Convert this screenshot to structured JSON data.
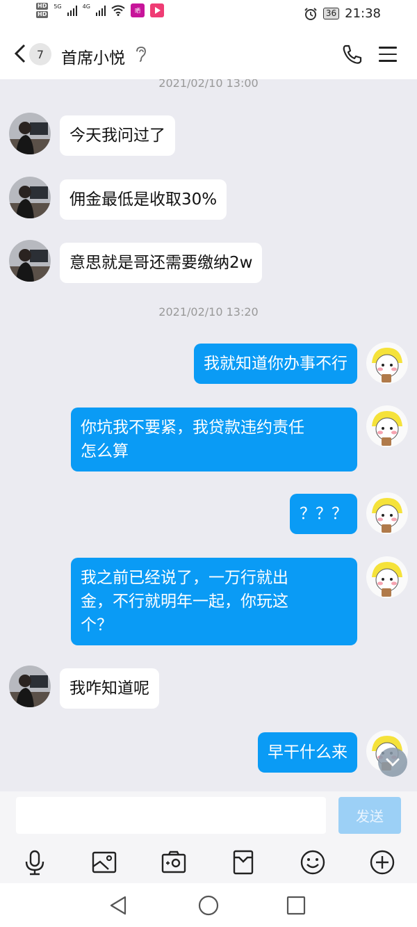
{
  "status_bar": {
    "hd1": "HD",
    "hd2": "HD",
    "net1": "5G",
    "net2": "4G",
    "app_badge": "晒",
    "battery": "36",
    "time": "21:38"
  },
  "header": {
    "unread_count": "7",
    "contact_name": "首席小悦"
  },
  "messages": {
    "ts1": "2021/02/10 13:00",
    "m1": "今天我问过了",
    "m2": "佣金最低是收取30%",
    "m3": "意思就是哥还需要缴纳2w",
    "ts2": "2021/02/10 13:20",
    "m4": "我就知道你办事不行",
    "m5_line1": "你坑我不要紧，我贷款违约责任",
    "m5_line2": "怎么算",
    "m6": "？？？",
    "m7_line1": "我之前已经说了，一万行就出",
    "m7_line2": "金，不行就明年一起，你玩这",
    "m7_line3": "个？",
    "m8": "我咋知道呢",
    "m9": "早干什么来"
  },
  "input_bar": {
    "send_label": "发送"
  },
  "colors": {
    "chat_bg": "#ebebf1",
    "self_bubble": "#0a9bf5",
    "other_bubble": "#ffffff",
    "send_disabled": "#9cd0f6"
  },
  "icons": {
    "toolbar": [
      "microphone-icon",
      "image-icon",
      "camera-icon",
      "file-icon",
      "emoji-icon",
      "plus-icon"
    ],
    "navigation": [
      "back-triangle-icon",
      "home-circle-icon",
      "recents-square-icon"
    ]
  }
}
